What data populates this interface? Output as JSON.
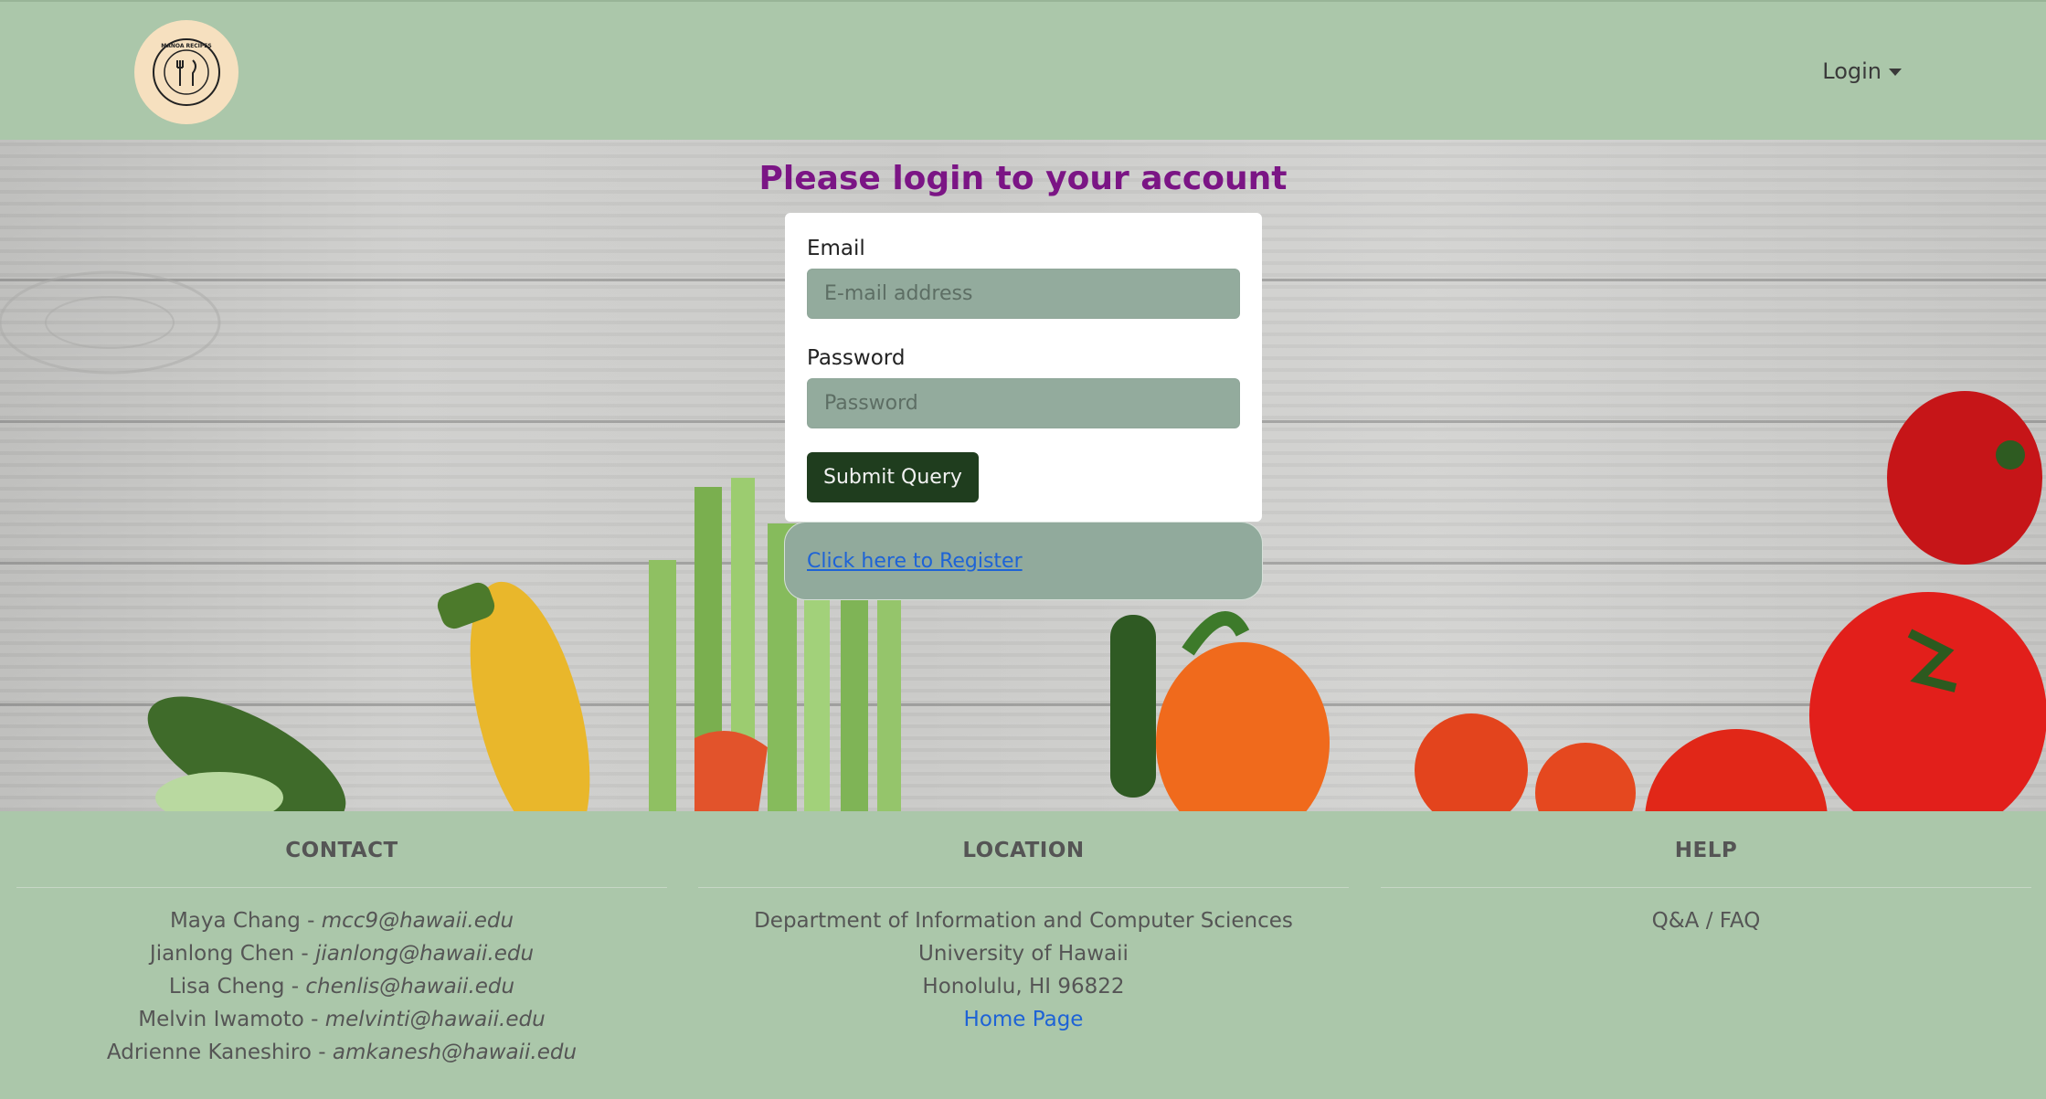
{
  "navbar": {
    "logo_text": "MANOA RECIPES",
    "login_label": "Login"
  },
  "login": {
    "title": "Please login to your account",
    "email_label": "Email",
    "email_placeholder": "E-mail address",
    "password_label": "Password",
    "password_placeholder": "Password",
    "submit_label": "Submit Query",
    "register_link": "Click here to Register"
  },
  "footer": {
    "contact": {
      "heading": "CONTACT",
      "people": [
        {
          "name": "Maya Chang - ",
          "email": "mcc9@hawaii.edu"
        },
        {
          "name": "Jianlong Chen - ",
          "email": "jianlong@hawaii.edu"
        },
        {
          "name": "Lisa Cheng - ",
          "email": "chenlis@hawaii.edu"
        },
        {
          "name": "Melvin Iwamoto - ",
          "email": "melvinti@hawaii.edu"
        },
        {
          "name": "Adrienne Kaneshiro - ",
          "email": "amkanesh@hawaii.edu"
        }
      ]
    },
    "location": {
      "heading": "LOCATION",
      "lines": [
        "Department of Information and Computer Sciences",
        "University of Hawaii",
        "Honolulu, HI 96822"
      ],
      "home_link": "Home Page"
    },
    "help": {
      "heading": "HELP",
      "link": "Q&A / FAQ"
    }
  },
  "colors": {
    "nav_bg": "#abc7aa",
    "title": "#7b1585",
    "input_bg": "#93ab9d",
    "button_bg": "#1f3d1e",
    "link": "#1e63d6",
    "logo_bg": "#f6e0bf"
  },
  "icons": {
    "logo": "recipe-logo-icon",
    "dropdown": "caret-down-icon"
  }
}
